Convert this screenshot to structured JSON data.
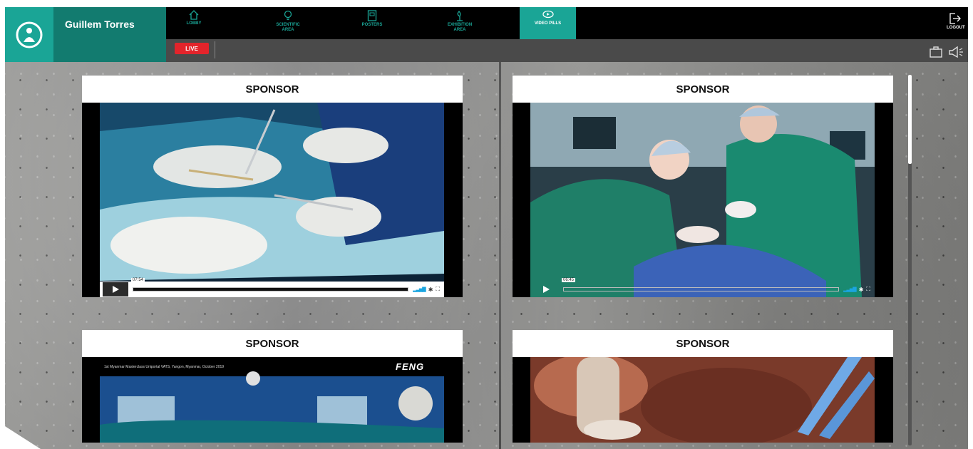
{
  "user": {
    "name": "Guillem Torres"
  },
  "nav": {
    "items": [
      {
        "label": "LOBBY",
        "icon": "home-icon"
      },
      {
        "label": "SCIENTIFIC\nAREA",
        "icon": "lightbulb-icon"
      },
      {
        "label": "POSTERS",
        "icon": "poster-icon"
      },
      {
        "label": "EXHIBITION\nAREA",
        "icon": "exhibition-icon"
      },
      {
        "label": "VIDEO PILLS",
        "icon": "video-pills-icon",
        "active": true
      }
    ],
    "logout_label": "LOGOUT"
  },
  "subbar": {
    "live_label": "LIVE"
  },
  "cards": [
    {
      "title": "SPONSOR",
      "time": "07:54"
    },
    {
      "title": "SPONSOR",
      "time": "06:45"
    },
    {
      "title": "SPONSOR",
      "caption": "1st Myanmar Masterclass Uniportal VATS, Yangon, Myanmar, October 2019",
      "brand": "FENG"
    },
    {
      "title": "SPONSOR"
    }
  ],
  "colors": {
    "accent": "#1aa596",
    "accent_dark": "#127b6f",
    "live": "#e3242b"
  }
}
